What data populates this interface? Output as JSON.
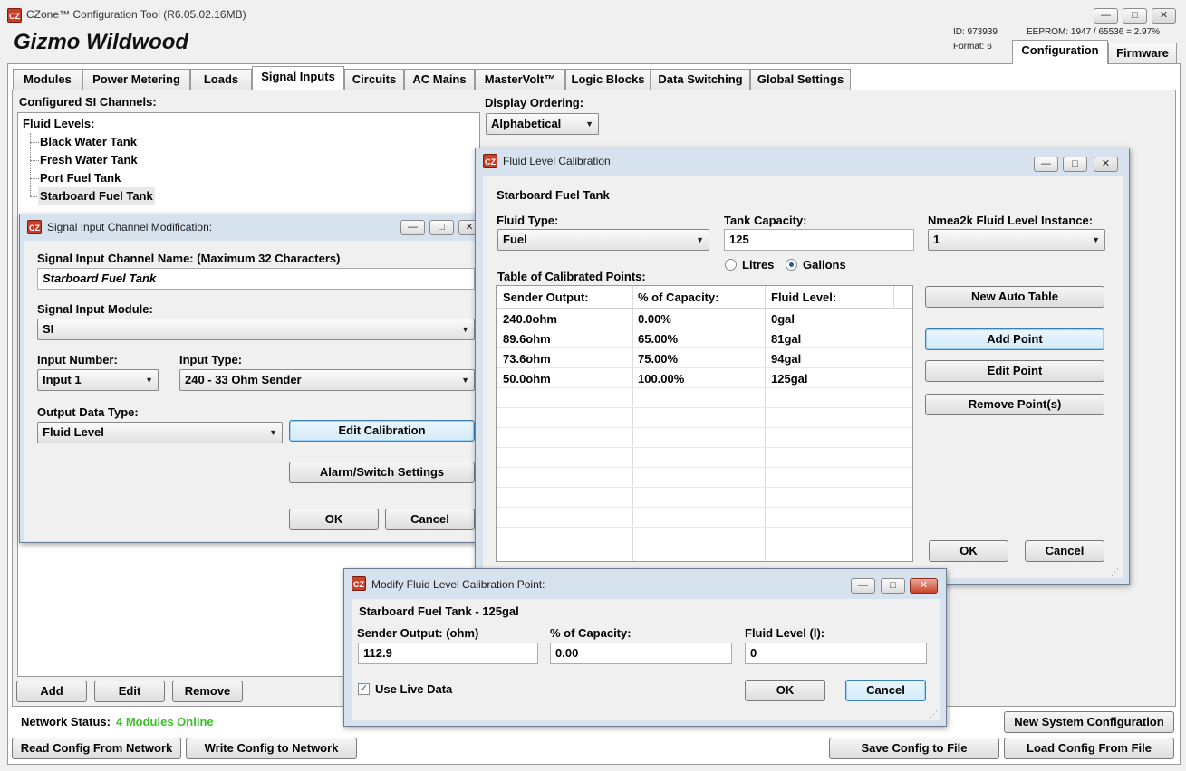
{
  "app": {
    "title": "CZone™ Configuration Tool (R6.05.02.16MB)",
    "icon": "CZ",
    "vessel_name": "Gizmo Wildwood",
    "id_text": "ID: 973939",
    "format_text": "Format: 6",
    "eeprom_text": "EEPROM: 1947 / 65536 = 2.97%",
    "mode_tabs": [
      {
        "label": "Configuration",
        "active": true
      },
      {
        "label": "Firmware",
        "active": false
      }
    ]
  },
  "tabs": [
    "Modules",
    "Power Metering",
    "Loads",
    "Signal Inputs",
    "Circuits",
    "AC Mains",
    "MasterVolt™",
    "Logic Blocks",
    "Data Switching",
    "Global Settings"
  ],
  "active_tab": "Signal Inputs",
  "si_panel": {
    "configured_label": "Configured SI Channels:",
    "display_ordering_label": "Display Ordering:",
    "display_ordering_value": "Alphabetical",
    "tree_group": "Fluid Levels:",
    "tree_items": [
      "Black Water Tank",
      "Fresh Water Tank",
      "Port Fuel Tank",
      "Starboard Fuel Tank"
    ],
    "add_label": "Add",
    "edit_label": "Edit",
    "remove_label": "Remove"
  },
  "footer": {
    "network_status_label": "Network Status:",
    "network_status_value": "4 Modules Online",
    "new_system_label": "New System Configuration",
    "read_label": "Read Config From Network",
    "write_label": "Write Config to Network",
    "save_label": "Save Config to File",
    "load_label": "Load Config From File",
    "status_color": "#3cbf2a"
  },
  "sicm": {
    "title": "Signal Input Channel Modification:",
    "name_label": "Signal Input Channel Name: (Maximum 32 Characters)",
    "name_value": "Starboard Fuel Tank",
    "module_label": "Signal Input Module:",
    "module_value": "SI",
    "input_number_label": "Input Number:",
    "input_number_value": "Input 1",
    "input_type_label": "Input Type:",
    "input_type_value": "240 - 33 Ohm Sender",
    "output_type_label": "Output Data Type:",
    "output_type_value": "Fluid Level",
    "edit_calibration_label": "Edit Calibration",
    "alarm_label": "Alarm/Switch Settings",
    "ok_label": "OK",
    "cancel_label": "Cancel"
  },
  "flc": {
    "title": "Fluid Level Calibration",
    "tank_name": "Starboard Fuel Tank",
    "fluid_type_label": "Fluid Type:",
    "fluid_type_value": "Fuel",
    "capacity_label": "Tank Capacity:",
    "capacity_value": "125",
    "nmea_label": "Nmea2k Fluid Level Instance:",
    "nmea_value": "1",
    "unit_litres": "Litres",
    "unit_gallons": "Gallons",
    "unit_selected": "Gallons",
    "table_label": "Table of Calibrated Points:",
    "columns": [
      "Sender Output:",
      "% of Capacity:",
      "Fluid Level:"
    ],
    "rows": [
      [
        "240.0ohm",
        "0.00%",
        "0gal"
      ],
      [
        "89.6ohm",
        "65.00%",
        "81gal"
      ],
      [
        "73.6ohm",
        "75.00%",
        "94gal"
      ],
      [
        "50.0ohm",
        "100.00%",
        "125gal"
      ]
    ],
    "new_auto_label": "New Auto Table",
    "add_point_label": "Add Point",
    "edit_point_label": "Edit Point",
    "remove_points_label": "Remove Point(s)",
    "ok_label": "OK",
    "cancel_label": "Cancel"
  },
  "mflcp": {
    "title": "Modify Fluid Level Calibration Point:",
    "subtitle": "Starboard Fuel Tank - 125gal",
    "sender_label": "Sender Output: (ohm)",
    "sender_value": "112.9",
    "capacity_label": "% of Capacity:",
    "capacity_value": "0.00",
    "fluid_label": "Fluid Level (l):",
    "fluid_value": "0",
    "live_label": "Use Live Data",
    "live_checked": true,
    "ok_label": "OK",
    "cancel_label": "Cancel"
  }
}
